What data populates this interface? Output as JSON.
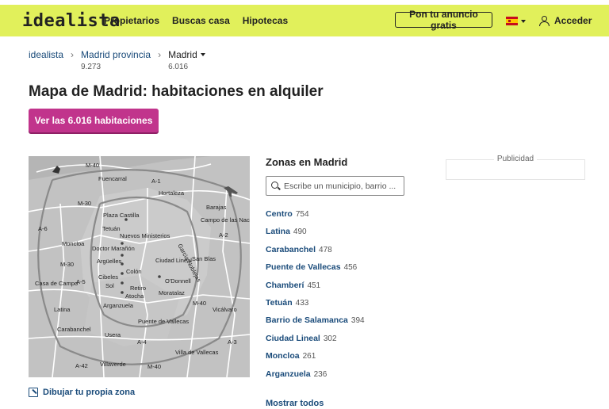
{
  "header": {
    "logo": "idealista",
    "nav": [
      "Propietarios",
      "Buscas casa",
      "Hipotecas"
    ],
    "publish_button": "Pon tu anuncio gratis",
    "login": "Acceder"
  },
  "breadcrumb": [
    {
      "label": "idealista",
      "count": ""
    },
    {
      "label": "Madrid provincia",
      "count": "9.273"
    },
    {
      "label": "Madrid",
      "count": "6.016"
    }
  ],
  "title": "Mapa de Madrid: habitaciones en alquiler",
  "cta": "Ver las 6.016 habitaciones",
  "map": {
    "labels": [
      "M-40",
      "Fuencarral",
      "A-1",
      "Hortaleza",
      "M-30",
      "Barajas",
      "Plaza Castilla",
      "Campo de las Naciones",
      "A-6",
      "Tetuán",
      "Nuevos Ministerios",
      "A-2",
      "Moncloa",
      "Doctor Marañón",
      "Argüelles",
      "Ciudad Lineal",
      "San Blas",
      "M-30",
      "Colón",
      "Casa de Campo",
      "A-5",
      "Cibeles",
      "Sol",
      "Retiro",
      "Atocha",
      "O'Donnell",
      "Moratalaz",
      "M-40",
      "Vicálvaro",
      "Arganzuela",
      "Latina",
      "Puente de Vallecas",
      "Carabanchel",
      "Usera",
      "A-4",
      "A-3",
      "Villa de Vallecas",
      "A-42",
      "Villaverde",
      "M-40",
      "Garcia Noblejas"
    ],
    "draw_link": "Dibujar tu propia zona"
  },
  "zones": {
    "title": "Zonas en Madrid",
    "search_placeholder": "Escribe un municipio, barrio ...",
    "items": [
      {
        "name": "Centro",
        "count": "754"
      },
      {
        "name": "Latina",
        "count": "490"
      },
      {
        "name": "Carabanchel",
        "count": "478"
      },
      {
        "name": "Puente de Vallecas",
        "count": "456"
      },
      {
        "name": "Chamberí",
        "count": "451"
      },
      {
        "name": "Tetuán",
        "count": "433"
      },
      {
        "name": "Barrio de Salamanca",
        "count": "394"
      },
      {
        "name": "Ciudad Lineal",
        "count": "302"
      },
      {
        "name": "Moncloa",
        "count": "261"
      },
      {
        "name": "Arganzuela",
        "count": "236"
      }
    ],
    "show_all": "Mostrar todos"
  },
  "ad_label": "Publicidad",
  "colors": {
    "header_bg": "#e1f05b",
    "cta_bg": "#c1348c",
    "link": "#1a4b7a"
  },
  "icons": [
    "user-icon",
    "search-icon",
    "flag-es-icon",
    "draw-zone-icon",
    "airplane-icon",
    "deer-icon"
  ]
}
